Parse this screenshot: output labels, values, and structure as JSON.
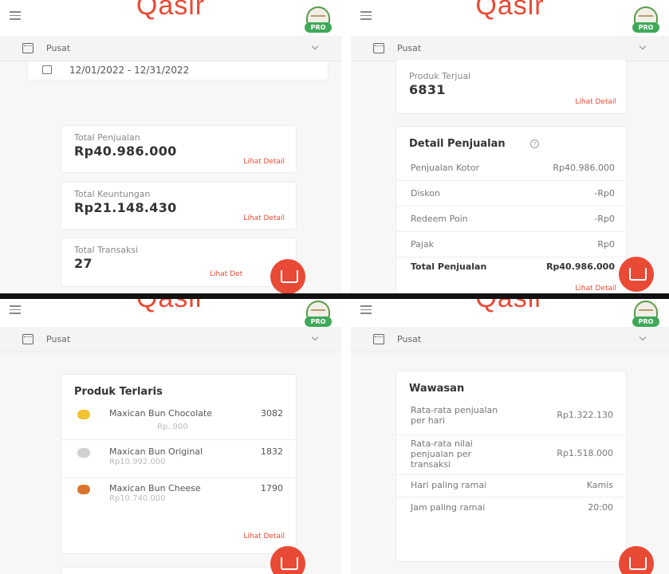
{
  "app": {
    "logo": "Qasir",
    "pro_badge": "PRO"
  },
  "outlet": {
    "name": "Pusat"
  },
  "screen1": {
    "date_range": "12/01/2022 - 12/31/2022",
    "cards": [
      {
        "label": "Total Penjualan",
        "value": "Rp40.986.000",
        "link": "Lihat Detail"
      },
      {
        "label": "Total Keuntungan",
        "value": "Rp21.148.430",
        "link": "Lihat Detail"
      },
      {
        "label": "Total Transaksi",
        "value": "27",
        "link": "Lihat Det"
      }
    ]
  },
  "screen2": {
    "sold": {
      "label": "Produk Terjual",
      "value": "6831",
      "link": "Lihat Detail"
    },
    "detail": {
      "title": "Detail Penjualan",
      "help_icon": "question-circle-icon",
      "rows": [
        {
          "label": "Penjualan Kotor",
          "value": "Rp40.986.000"
        },
        {
          "label": "Diskon",
          "value": "-Rp0"
        },
        {
          "label": "Redeem Poin",
          "value": "-Rp0"
        },
        {
          "label": "Pajak",
          "value": "Rp0"
        }
      ],
      "total": {
        "label": "Total Penjualan",
        "value": "Rp40.986.000"
      },
      "link": "Lihat Detail"
    }
  },
  "screen3": {
    "title": "Produk Terlaris",
    "items": [
      {
        "name": "Maxican Bun Chocolate",
        "qty": "3082",
        "price": "Rp..000",
        "medal": "#f2c230"
      },
      {
        "name": "Maxican Bun Original",
        "qty": "1832",
        "price": "Rp10.992.000",
        "medal": "#d0d0d0"
      },
      {
        "name": "Maxican Bun Cheese",
        "qty": "1790",
        "price": "Rp10.740.000",
        "medal": "#d9762e"
      }
    ],
    "link": "Lihat Detail"
  },
  "screen4": {
    "title": "Wawasan",
    "rows": [
      {
        "label": "Rata-rata penjualan per hari",
        "value": "Rp1.322.130"
      },
      {
        "label": "Rata-rata nilai penjualan per transaksi",
        "value": "Rp1.518.000"
      },
      {
        "label": "Hari paling ramai",
        "value": "Kamis"
      },
      {
        "label": "Jam paling ramai",
        "value": "20:00"
      }
    ]
  },
  "colors": {
    "brand": "#e94a35",
    "pro_green": "#3fa95a",
    "bg": "#f7f7f7"
  }
}
